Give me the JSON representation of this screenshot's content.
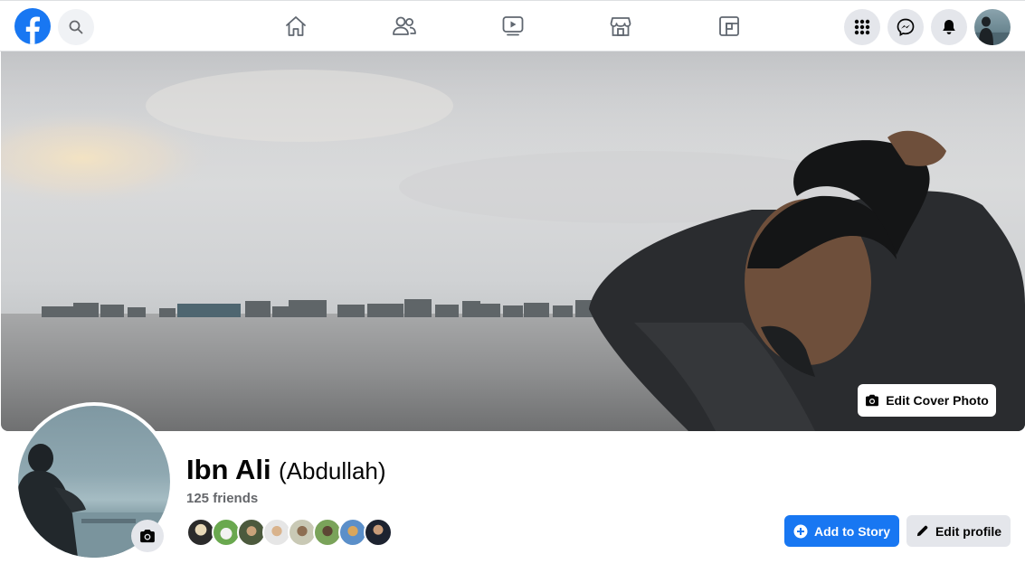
{
  "nav": {
    "logo_icon": "facebook-logo-icon",
    "search_icon": "search-icon",
    "center_icons": [
      "home-icon",
      "friends-icon",
      "watch-icon",
      "marketplace-icon",
      "gaming-icon"
    ],
    "right_icons": [
      "menu-grid-icon",
      "messenger-icon",
      "notifications-icon",
      "account-avatar"
    ]
  },
  "cover": {
    "edit_label": "Edit Cover Photo"
  },
  "profile": {
    "name": "Ibn Ali",
    "alternate_name": "(Abdullah)",
    "friends_count": "125 friends"
  },
  "actions": {
    "add_story_label": "Add to Story",
    "edit_profile_label": "Edit profile"
  },
  "colors": {
    "brand_blue": "#1877f2",
    "secondary_button": "#e4e6eb",
    "muted_text": "#65676b"
  }
}
